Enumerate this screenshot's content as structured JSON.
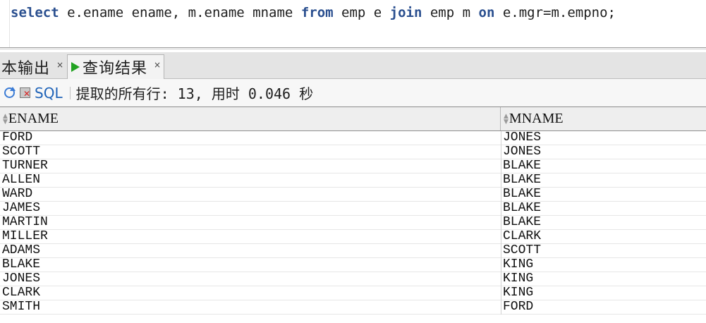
{
  "editor": {
    "sql_tokens": [
      {
        "text": "select",
        "kw": true
      },
      {
        "text": " e.ename ename, m.ename mname ",
        "kw": false
      },
      {
        "text": "from",
        "kw": true
      },
      {
        "text": " emp e ",
        "kw": false
      },
      {
        "text": "join",
        "kw": true
      },
      {
        "text": " emp m ",
        "kw": false
      },
      {
        "text": "on",
        "kw": true
      },
      {
        "text": " e.mgr=m.empno;",
        "kw": false
      }
    ]
  },
  "tabs": [
    {
      "label": "本输出",
      "close": "×",
      "active": false
    },
    {
      "label": "查询结果",
      "close": "×",
      "active": true
    }
  ],
  "toolbar": {
    "sql_label": "SQL",
    "status": "提取的所有行: 13, 用时 0.046 秒"
  },
  "grid": {
    "columns": [
      "ENAME",
      "MNAME"
    ],
    "rows": [
      [
        "FORD",
        "JONES"
      ],
      [
        "SCOTT",
        "JONES"
      ],
      [
        "TURNER",
        "BLAKE"
      ],
      [
        "ALLEN",
        "BLAKE"
      ],
      [
        "WARD",
        "BLAKE"
      ],
      [
        "JAMES",
        "BLAKE"
      ],
      [
        "MARTIN",
        "BLAKE"
      ],
      [
        "MILLER",
        "CLARK"
      ],
      [
        "ADAMS",
        "SCOTT"
      ],
      [
        "BLAKE",
        "KING"
      ],
      [
        "JONES",
        "KING"
      ],
      [
        "CLARK",
        "KING"
      ],
      [
        "SMITH",
        "FORD"
      ]
    ]
  },
  "colors": {
    "keyword": "#2a4f8f",
    "run_icon": "#22a322",
    "sql_link": "#1f63b8"
  }
}
